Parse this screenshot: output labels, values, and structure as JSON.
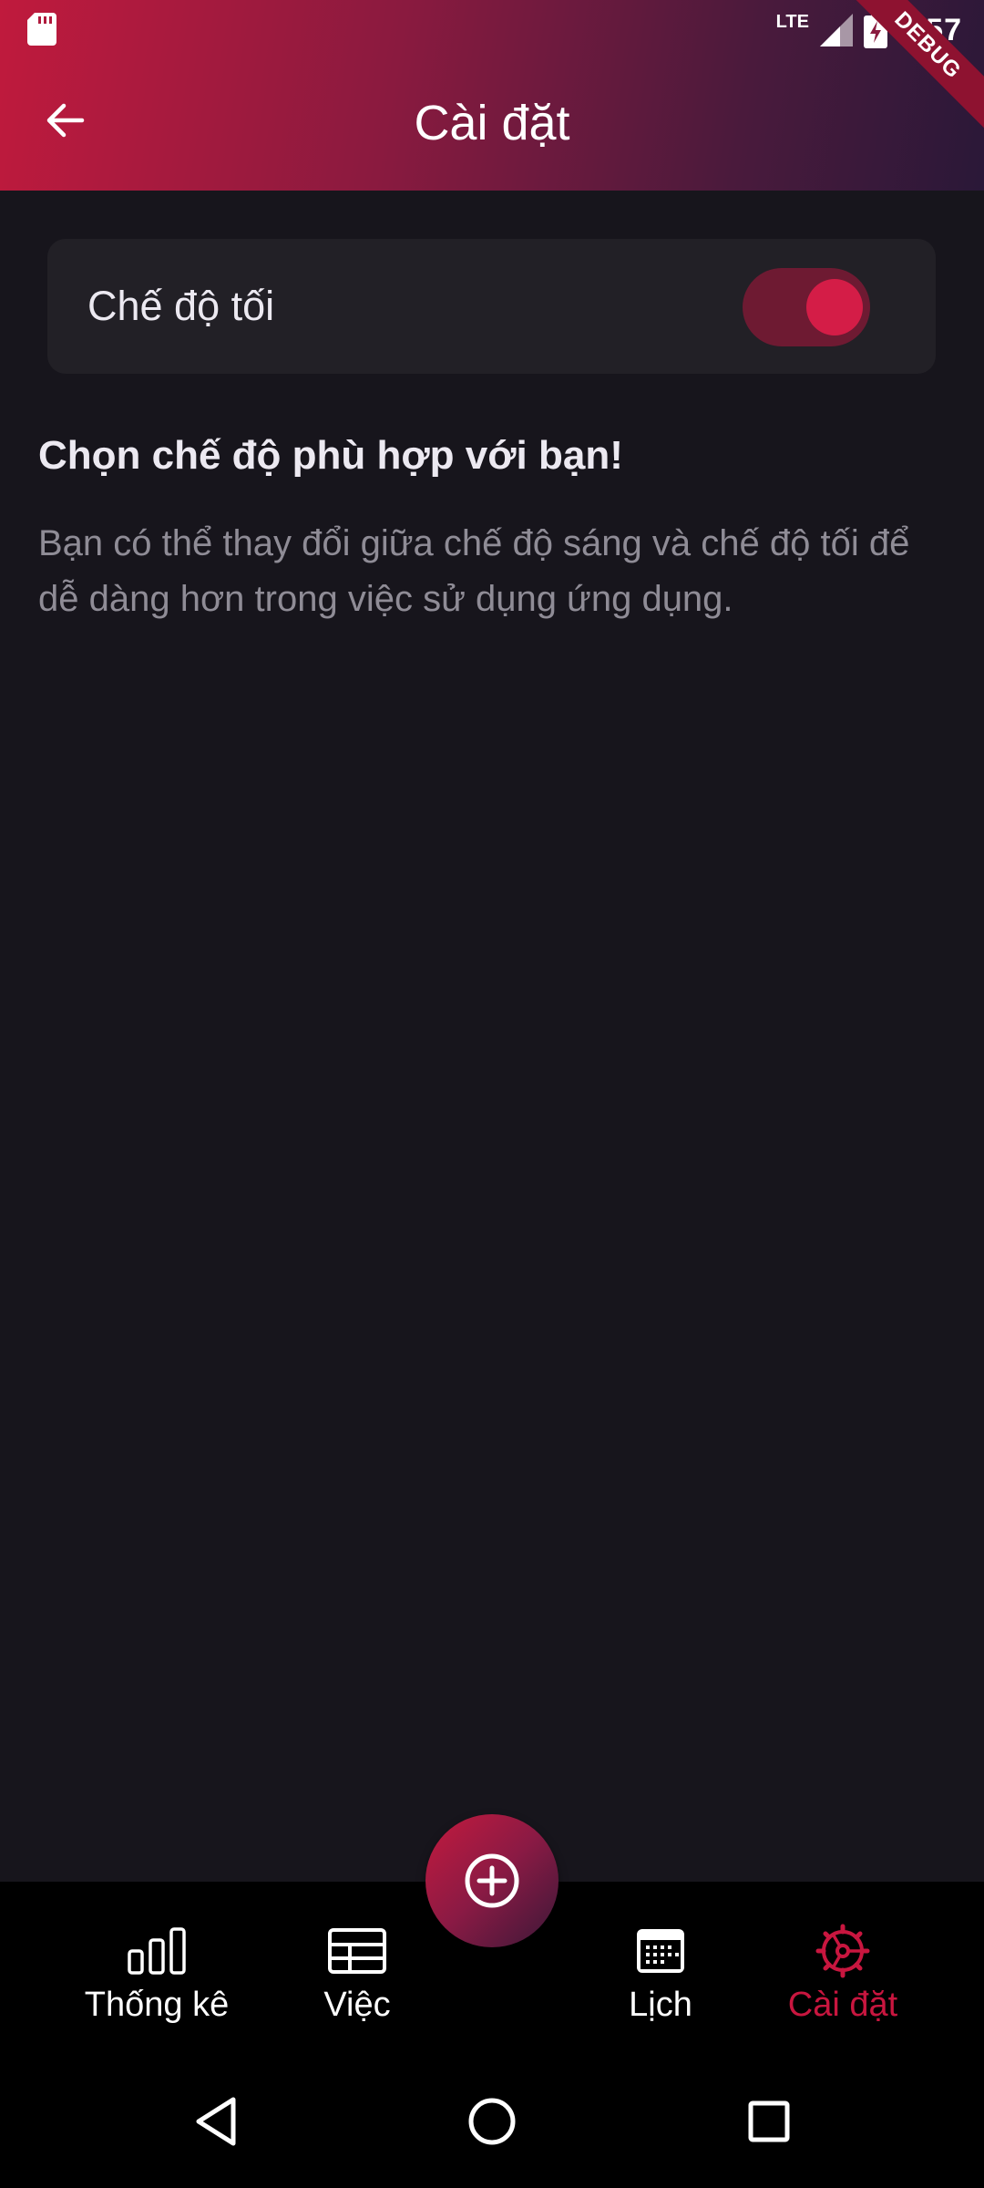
{
  "status_bar": {
    "network": "LTE",
    "time": "3:57",
    "debug_label": "DEBUG"
  },
  "header": {
    "title": "Cài đặt",
    "back_icon": "arrow-left-icon"
  },
  "settings": {
    "dark_mode_label": "Chế độ tối",
    "dark_mode_enabled": true,
    "heading": "Chọn chế độ phù hợp với bạn!",
    "description": "Bạn có thể thay đổi giữa chế độ sáng và chế độ tối để dễ dàng hơn trong việc sử dụng ứng dụng."
  },
  "bottom_nav": {
    "items": [
      {
        "label": "Thống kê",
        "icon": "bar-chart-icon",
        "active": false
      },
      {
        "label": "Việc",
        "icon": "table-icon",
        "active": false
      },
      {
        "label": "Lịch",
        "icon": "calendar-icon",
        "active": false
      },
      {
        "label": "Cài đặt",
        "icon": "settings-icon",
        "active": true
      }
    ],
    "fab_icon": "add-circle-icon"
  },
  "colors": {
    "accent": "#c8163f",
    "background": "#17151c",
    "card": "#222026",
    "toggle_track": "#6e1a32",
    "toggle_thumb": "#d41d47"
  }
}
